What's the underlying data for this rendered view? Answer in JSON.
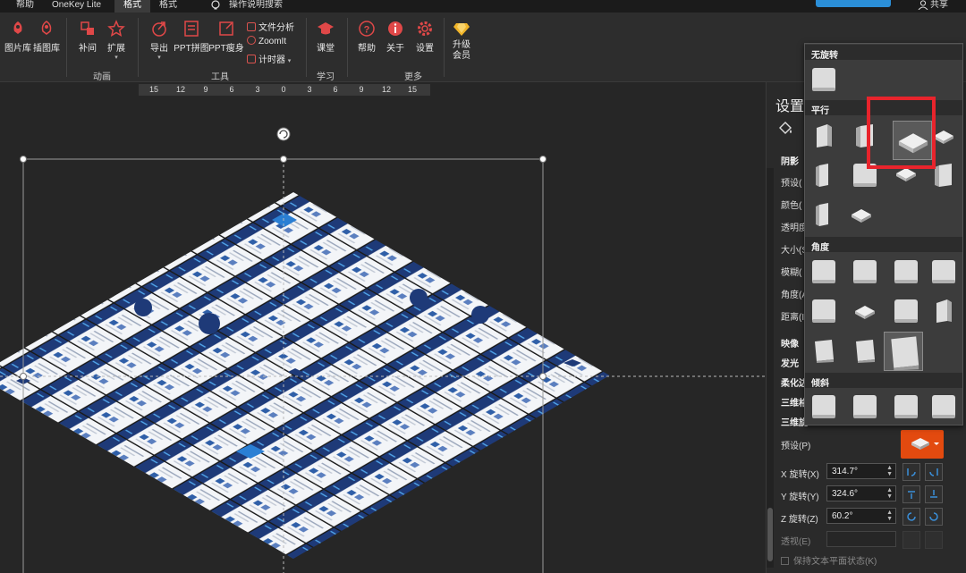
{
  "tabbar": {
    "items": [
      "帮助",
      "OneKey Lite",
      "格式",
      "格式",
      "操作说明搜索"
    ],
    "share_label": "共享"
  },
  "ribbon": {
    "buttons": {
      "picture_lib": "图片库",
      "illustration_lib": "插图库",
      "tween": "补间",
      "extend": "扩展",
      "export": "导出",
      "ppt_collage": "PPT拼图",
      "ppt_slim": "PPT瘦身",
      "course": "课堂",
      "help": "帮助",
      "about": "关于",
      "settings": "设置",
      "upgrade": "升级会员"
    },
    "small_items": [
      "文件分析",
      "ZoomIt",
      "计时器"
    ],
    "groups": [
      "动画",
      "工具",
      "学习",
      "更多"
    ]
  },
  "ruler": {
    "ticks": [
      "15",
      "12",
      "9",
      "6",
      "3",
      "0",
      "3",
      "6",
      "9",
      "12",
      "15"
    ]
  },
  "pane": {
    "title": "设置",
    "labels": [
      "阴影",
      "预设(",
      "颜色(",
      "透明度",
      "大小(S",
      "模糊(",
      "角度(A",
      "距离(I",
      "映像",
      "发光",
      "柔化边",
      "三维格",
      "三维旋"
    ],
    "preset_label": "预设(P)",
    "x_label": "X 旋转(X)",
    "x_value": "314.7°",
    "y_label": "Y 旋转(Y)",
    "y_value": "324.6°",
    "z_label": "Z 旋转(Z)",
    "z_value": "60.2°",
    "perspective_label": "透视(E)",
    "keep_flat_label": "保持文本平面状态(K)"
  },
  "dropdown": {
    "sections": [
      "无旋转",
      "平行",
      "角度",
      "倾斜"
    ]
  },
  "colors": {
    "accent": "#e34a0f",
    "highlight": "#e8242c",
    "slide_blue": "#1e3a78"
  }
}
